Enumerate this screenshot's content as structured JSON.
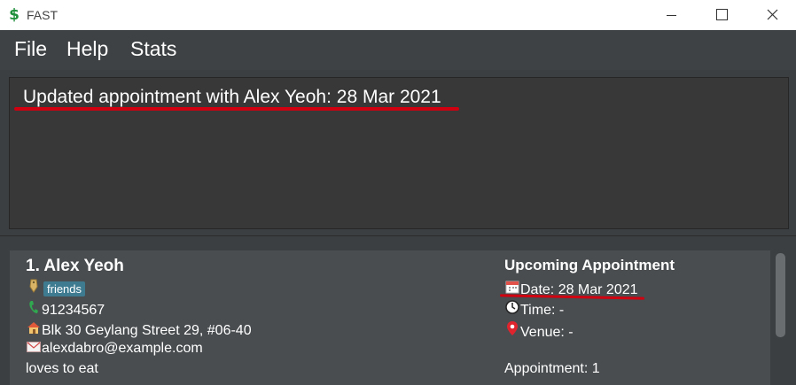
{
  "window": {
    "title": "FAST",
    "app_icon": "$"
  },
  "menu": {
    "items": [
      "File",
      "Help",
      "Stats"
    ]
  },
  "result": {
    "message": "Updated appointment with Alex Yeoh: 28 Mar 2021"
  },
  "person": {
    "index_name": "1.  Alex Yeoh",
    "tag": "friends",
    "phone": "91234567",
    "address": "Blk 30 Geylang Street 29, #06-40",
    "email": "alexdabro@example.com",
    "remark": "loves to eat",
    "icons": {
      "tag": "tag-icon",
      "phone": "phone-icon",
      "address": "house-icon",
      "email": "envelope-icon"
    }
  },
  "appointment": {
    "heading": "Upcoming Appointment",
    "date": "Date: 28 Mar 2021",
    "time": "Time: -",
    "venue": "Venue: -",
    "count": "Appointment: 1",
    "icons": {
      "date": "calendar-icon",
      "time": "clock-icon",
      "venue": "location-pin-icon"
    }
  },
  "colors": {
    "tag_bg": "#3e7b91",
    "annotation_red": "#d00010",
    "app_icon_green": "#1e8f3a"
  }
}
